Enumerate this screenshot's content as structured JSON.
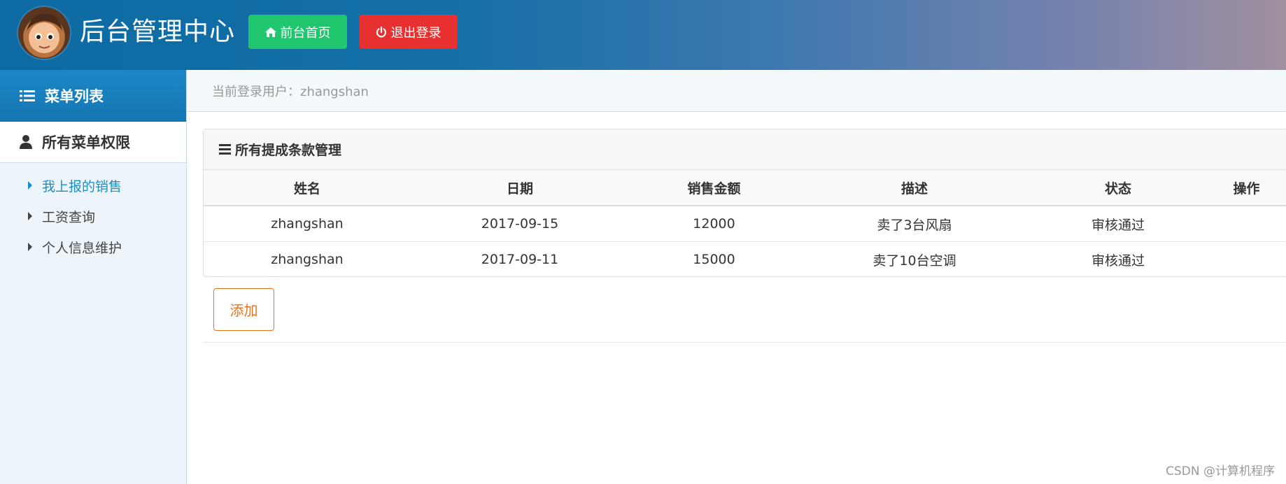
{
  "header": {
    "title": "后台管理中心",
    "home_button": "前台首页",
    "logout_button": "退出登录"
  },
  "sidebar": {
    "menu_title": "菜单列表",
    "group_title": "所有菜单权限",
    "items": [
      {
        "label": "我上报的销售",
        "active": true
      },
      {
        "label": "工资查询",
        "active": false
      },
      {
        "label": "个人信息维护",
        "active": false
      }
    ]
  },
  "userbar": {
    "text": "当前登录用户：zhangshan"
  },
  "panel": {
    "title": "所有提成条款管理",
    "columns": [
      "姓名",
      "日期",
      "销售金额",
      "描述",
      "状态",
      "操作"
    ],
    "rows": [
      [
        "zhangshan",
        "2017-09-15",
        "12000",
        "卖了3台风扇",
        "审核通过",
        ""
      ],
      [
        "zhangshan",
        "2017-09-11",
        "15000",
        "卖了10台空调",
        "审核通过",
        ""
      ]
    ]
  },
  "add_button": "添加",
  "watermark": "CSDN @计算机程序",
  "colors": {
    "home_button": "#1fc66e",
    "logout_button": "#e7302f",
    "active_menu": "#1a8fc8",
    "add_button": "#e8731f"
  }
}
